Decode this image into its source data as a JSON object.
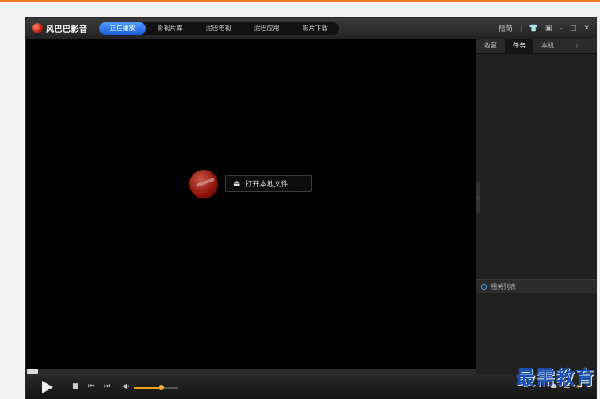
{
  "app": {
    "name": "风巴巴影音"
  },
  "nav": {
    "tabs": [
      {
        "label": "正在播放",
        "active": true
      },
      {
        "label": "影视片库",
        "active": false
      },
      {
        "label": "泥巴电视",
        "active": false
      },
      {
        "label": "泥巴应用",
        "active": false
      },
      {
        "label": "影片下载",
        "active": false
      }
    ]
  },
  "window_controls": {
    "compact_label": "精简",
    "skin_icon": "shirt-icon",
    "menu_icon": "menu-box-icon",
    "minimize": "–",
    "maximize": "□",
    "close": "✕"
  },
  "player": {
    "open_file_label": "打开本地文件...",
    "eject_glyph": "⏏"
  },
  "sidebar": {
    "tabs": [
      {
        "label": "收藏",
        "active": false
      },
      {
        "label": "任务",
        "active": true
      },
      {
        "label": "本机",
        "active": false
      }
    ],
    "trash_glyph": "🗑",
    "collapse_glyph": "›",
    "related_label": "相关列表"
  },
  "playback": {
    "progress": 0.0,
    "volume": 0.6
  },
  "controls": {
    "stop": "■",
    "prev": "⏮",
    "next": "⏭",
    "volume_glyph": "🔈",
    "eject": "⏏",
    "list": "☰",
    "folder": "📁"
  },
  "watermark": {
    "text": "最需教育"
  },
  "colors": {
    "accent": "#ee7a1e",
    "active_tab": "#1b5fd6",
    "volume": "#f0a020",
    "watermark": "#1a4fb4"
  }
}
